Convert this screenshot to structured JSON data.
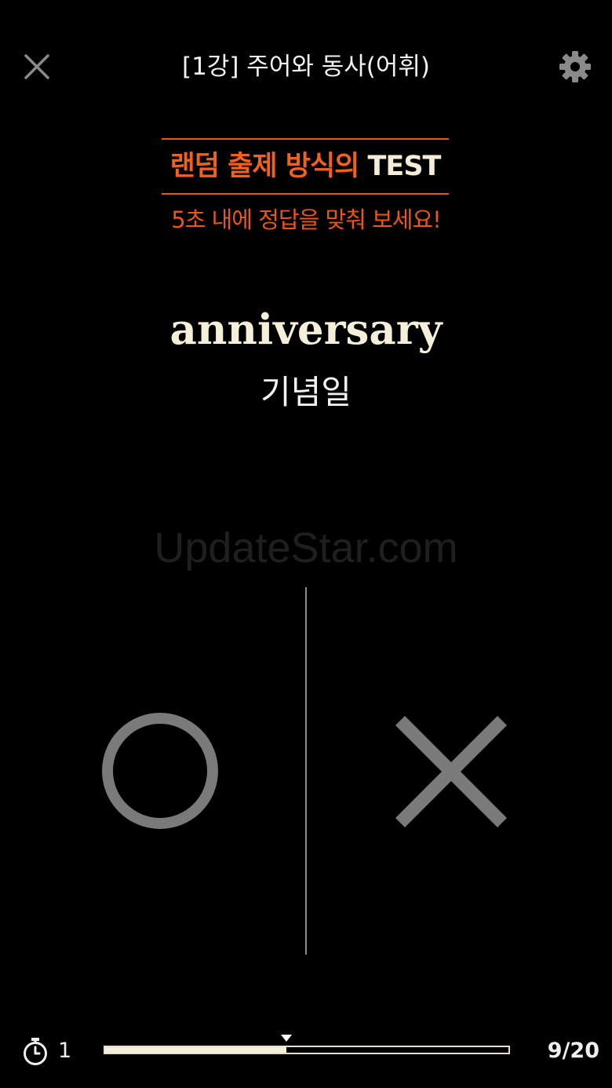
{
  "header": {
    "title": "[1강] 주어와 동사(어휘)",
    "close_icon": "close-icon",
    "settings_icon": "gear-icon"
  },
  "banner": {
    "highlight": "랜덤 출제 방식의 ",
    "test": "TEST",
    "subtitle": "5초 내에 정답을 맞춰 보세요!"
  },
  "question": {
    "word": "anniversary",
    "meaning": "기념일"
  },
  "watermark": "UpdateStar.com",
  "answers": {
    "correct_icon": "circle-o-icon",
    "wrong_icon": "x-mark-icon"
  },
  "footer": {
    "timer_icon": "stopwatch-icon",
    "timer_value": "1",
    "progress_fraction": 0.45,
    "counter": "9/20"
  },
  "colors": {
    "accent": "#e8561c",
    "word": "#f5efd9",
    "answer_mark": "#7a7a7a",
    "background": "#000000"
  }
}
